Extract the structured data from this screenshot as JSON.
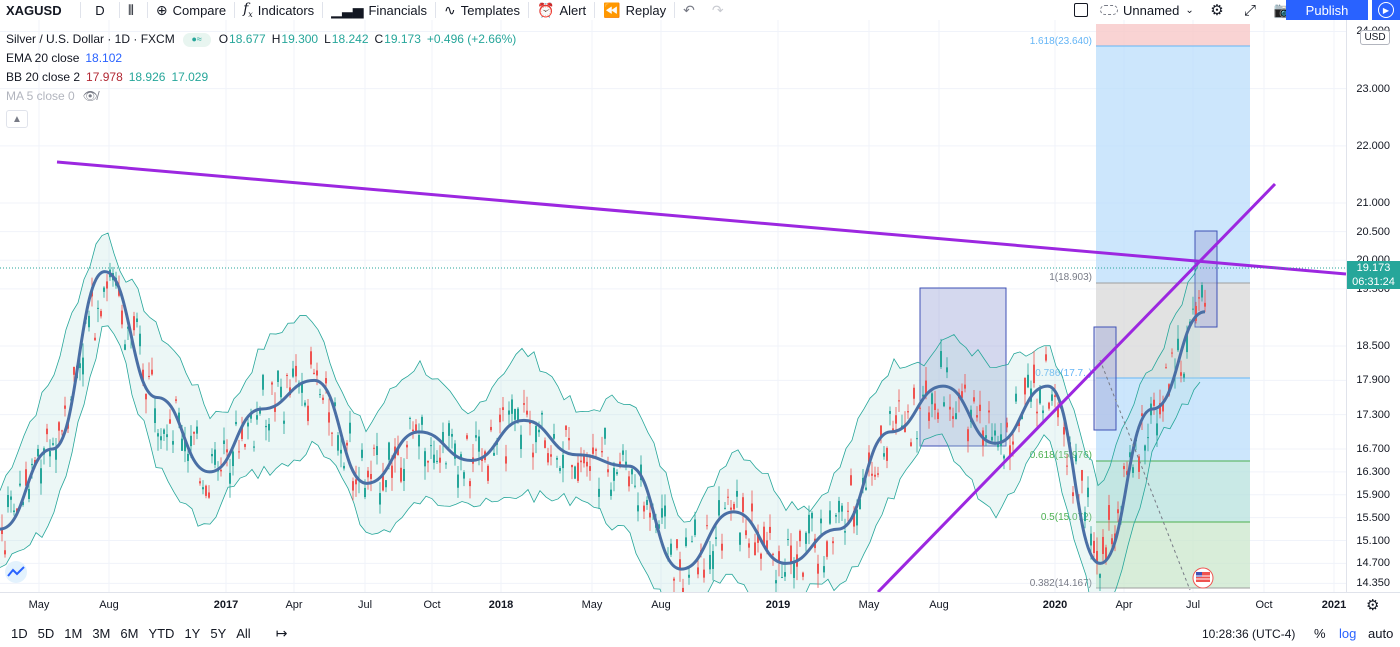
{
  "toolbar": {
    "symbol": "XAGUSD",
    "interval": "D",
    "compare": "Compare",
    "indicators": "Indicators",
    "financials": "Financials",
    "templates": "Templates",
    "alert": "Alert",
    "replay": "Replay",
    "layout_name": "Unnamed",
    "publish": "Publish"
  },
  "legend": {
    "title": "Silver / U.S. Dollar · 1D · FXCM",
    "open_label": "O",
    "open": "18.677",
    "high_label": "H",
    "high": "19.300",
    "low_label": "L",
    "low": "18.242",
    "close_label": "C",
    "close": "19.173",
    "change": "+0.496 (+2.66%)",
    "ema_name": "EMA 20 close",
    "ema_value": "18.102",
    "bb_name": "BB 20 close 2",
    "bb_basis": "17.978",
    "bb_upper": "18.926",
    "bb_lower": "17.029",
    "ma_name": "MA 5 close 0"
  },
  "price_axis": {
    "currency": "USD",
    "labels": [
      "24.000",
      "23.000",
      "22.000",
      "21.000",
      "20.500",
      "20.000",
      "19.500",
      "18.500",
      "17.900",
      "17.300",
      "16.700",
      "16.300",
      "15.900",
      "15.500",
      "15.100",
      "14.700",
      "14.350"
    ],
    "last_price": "19.173",
    "countdown": "06:31:24"
  },
  "time_axis": {
    "labels": [
      {
        "text": "May",
        "bold": false
      },
      {
        "text": "Aug",
        "bold": false
      },
      {
        "text": "2017",
        "bold": true
      },
      {
        "text": "Apr",
        "bold": false
      },
      {
        "text": "Jul",
        "bold": false
      },
      {
        "text": "Oct",
        "bold": false
      },
      {
        "text": "2018",
        "bold": true
      },
      {
        "text": "May",
        "bold": false
      },
      {
        "text": "Aug",
        "bold": false
      },
      {
        "text": "2019",
        "bold": true
      },
      {
        "text": "May",
        "bold": false
      },
      {
        "text": "Aug",
        "bold": false
      },
      {
        "text": "2020",
        "bold": true
      },
      {
        "text": "Apr",
        "bold": false
      },
      {
        "text": "Jul",
        "bold": false
      },
      {
        "text": "Oct",
        "bold": false
      },
      {
        "text": "2021",
        "bold": true
      }
    ]
  },
  "fib_levels": [
    {
      "label": "1.618(23.640)",
      "color": "#64b5f6"
    },
    {
      "label": "1(18.903)",
      "color": "#787b86"
    },
    {
      "label": "0.786(17.7..)",
      "color": "#64b5f6"
    },
    {
      "label": "0.618(15.976)",
      "color": "#4caf50"
    },
    {
      "label": "0.5(15.072)",
      "color": "#4caf50"
    },
    {
      "label": "0.382(14.167)",
      "color": "#787b86"
    }
  ],
  "bottombar": {
    "ranges": [
      "1D",
      "5D",
      "1M",
      "3M",
      "6M",
      "YTD",
      "1Y",
      "5Y",
      "All"
    ],
    "clock": "10:28:36 (UTC-4)",
    "percent": "%",
    "log": "log",
    "auto": "auto"
  },
  "colors": {
    "accent": "#2962ff",
    "trendline": "#9c27e0",
    "up": "#26a69a",
    "down": "#ef5350",
    "ema": "#4a6fa5"
  },
  "chart_data": {
    "type": "candlestick",
    "symbol": "XAGUSD",
    "timeframe": "1D",
    "ylim": [
      14.2,
      24.2
    ],
    "series": [
      {
        "name": "EMA 20 close",
        "values": [
          15.3,
          16.7,
          19.8,
          17.6,
          16.3,
          17.4,
          17.9,
          16.1,
          17.0,
          16.5,
          17.2,
          16.6,
          16.4,
          14.6,
          15.6,
          14.7,
          15.3,
          17.0,
          17.8,
          16.8,
          17.8,
          14.7,
          17.4,
          19.1
        ]
      }
    ],
    "ohlc": {
      "open": 18.677,
      "high": 19.3,
      "low": 18.242,
      "close": 19.173
    },
    "last_price": 19.173
  }
}
